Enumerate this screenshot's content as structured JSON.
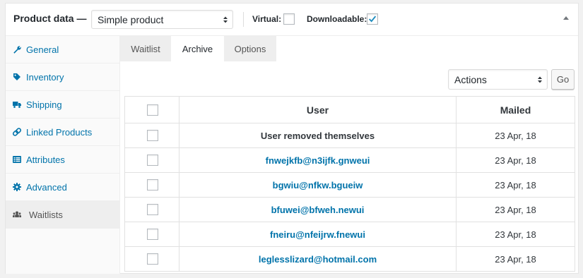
{
  "header": {
    "title": "Product data —",
    "product_type": "Simple product",
    "virtual_label": "Virtual:",
    "virtual_checked": false,
    "downloadable_label": "Downloadable:",
    "downloadable_checked": true,
    "accent_color": "#0073aa"
  },
  "sidebar": {
    "items": [
      {
        "label": "General",
        "icon": "wrench-icon"
      },
      {
        "label": "Inventory",
        "icon": "tag-icon"
      },
      {
        "label": "Shipping",
        "icon": "truck-icon"
      },
      {
        "label": "Linked Products",
        "icon": "link-icon"
      },
      {
        "label": "Attributes",
        "icon": "list-icon"
      },
      {
        "label": "Advanced",
        "icon": "gear-icon"
      },
      {
        "label": "Waitlists",
        "icon": "group-icon",
        "active": true
      }
    ]
  },
  "tabs": [
    {
      "label": "Waitlist"
    },
    {
      "label": "Archive",
      "active": true
    },
    {
      "label": "Options"
    }
  ],
  "bulk": {
    "action_value": "Actions",
    "go_label": "Go"
  },
  "table": {
    "headers": {
      "user": "User",
      "mailed": "Mailed"
    },
    "rows": [
      {
        "user": "User removed themselves",
        "mailed": "23 Apr, 18"
      },
      {
        "user": "fnwejkfb@n3ijfk.gnweui",
        "mailed": "23 Apr, 18"
      },
      {
        "user": "bgwiu@nfkw.bgueiw",
        "mailed": "23 Apr, 18"
      },
      {
        "user": "bfuwei@bfweh.newui",
        "mailed": "23 Apr, 18"
      },
      {
        "user": "fneiru@nfeijrw.fnewui",
        "mailed": "23 Apr, 18"
      },
      {
        "user": "leglesslizard@hotmail.com",
        "mailed": "23 Apr, 18"
      }
    ]
  }
}
